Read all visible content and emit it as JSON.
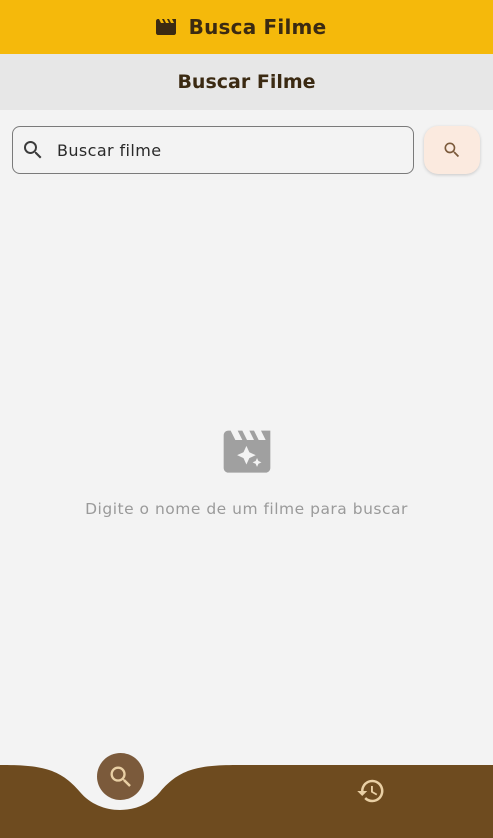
{
  "appbar": {
    "title": "Busca Filme",
    "icon": "movie-clapper-icon"
  },
  "page": {
    "title": "Buscar Filme"
  },
  "search": {
    "placeholder": "Buscar filme",
    "value": "",
    "leading_icon": "search-icon",
    "button_icon": "search-icon"
  },
  "empty_state": {
    "icon": "movie-filter-icon",
    "message": "Digite o nome de um filme para buscar"
  },
  "bottom_nav": {
    "items": [
      {
        "icon": "search-icon",
        "active": true
      },
      {
        "icon": "history-icon",
        "active": false
      }
    ]
  },
  "colors": {
    "appbar": "#f5b90b",
    "nav_background": "#6e4b1f",
    "nav_active": "#7b5a3b",
    "text_dark": "#3b2a12",
    "muted": "#9a9a9a"
  }
}
